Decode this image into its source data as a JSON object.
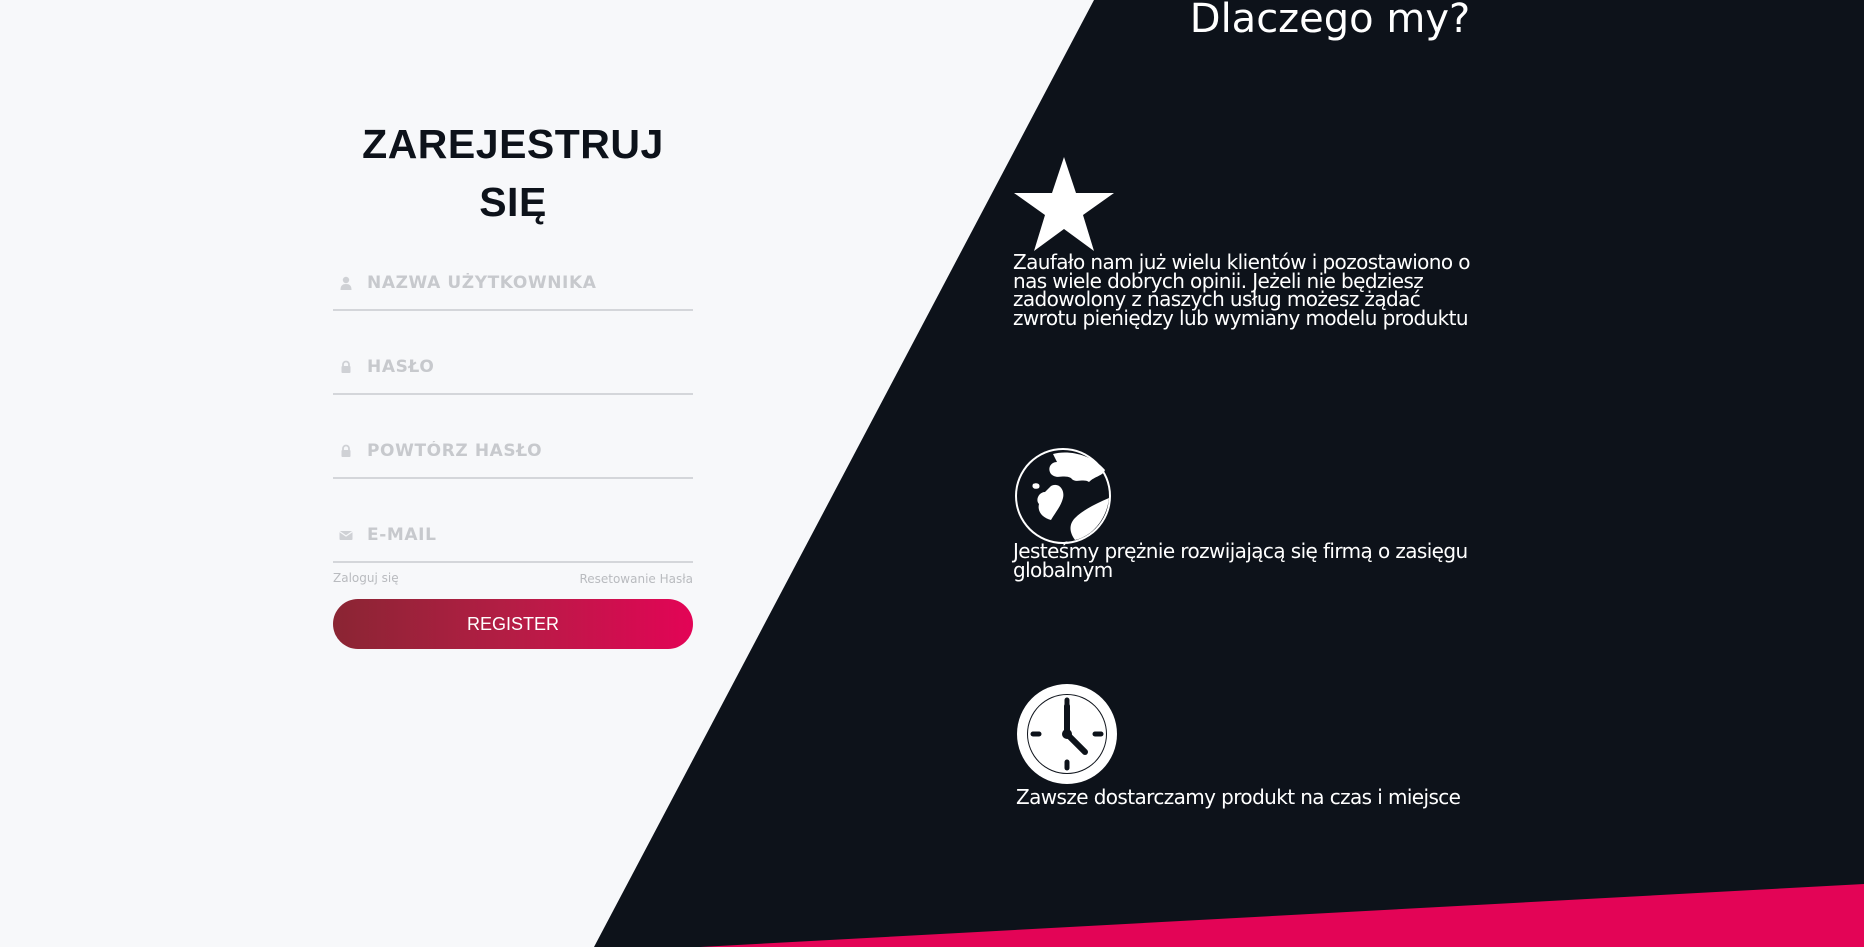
{
  "register": {
    "title_line1": "ZAREJESTRUJ",
    "title_line2": "SIĘ",
    "fields": [
      {
        "icon": "user-icon",
        "placeholder": "NAZWA UŻYTKOWNIKA",
        "value": ""
      },
      {
        "icon": "lock-icon",
        "placeholder": "HASŁO",
        "value": ""
      },
      {
        "icon": "lock-icon",
        "placeholder": "POWTÓRZ HASŁO",
        "value": ""
      },
      {
        "icon": "envelope-icon",
        "placeholder": "E-MAIL",
        "value": ""
      }
    ],
    "login_link": "Zaloguj się",
    "reset_link": "Resetowanie Hasła",
    "submit_label": "REGISTER"
  },
  "why": {
    "title": "Dlaczego my?",
    "features": [
      {
        "icon": "star-icon",
        "text": "Zaufało nam już wielu klientów i pozostawiono o nas wiele dobrych opinii. Jeżeli nie będziesz zadowolony z naszych usług możesz żądać zwrotu pieniędzy lub wymiany modelu produktu"
      },
      {
        "icon": "globe-icon",
        "text": "Jesteśmy prężnie rozwijającą się firmą o zasięgu globalnym"
      },
      {
        "icon": "clock-icon",
        "text": "Zawsze dostarczamy produkt na czas i miejsce"
      }
    ]
  },
  "colors": {
    "background": "#f7f8fa",
    "dark_panel": "#0d121a",
    "accent": "#e30456",
    "button_gradient_start": "#8a2533",
    "button_gradient_end": "#e30456"
  }
}
